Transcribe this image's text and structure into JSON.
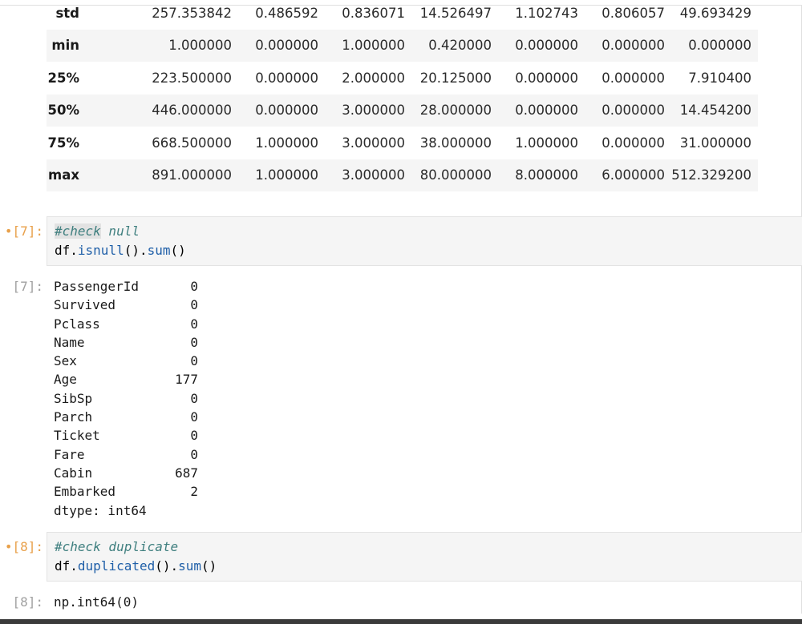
{
  "describe_table": {
    "rows": [
      {
        "label": "std",
        "values": [
          "257.353842",
          "0.486592",
          "0.836071",
          "14.526497",
          "1.102743",
          "0.806057",
          "49.693429"
        ]
      },
      {
        "label": "min",
        "values": [
          "1.000000",
          "0.000000",
          "1.000000",
          "0.420000",
          "0.000000",
          "0.000000",
          "0.000000"
        ]
      },
      {
        "label": "25%",
        "values": [
          "223.500000",
          "0.000000",
          "2.000000",
          "20.125000",
          "0.000000",
          "0.000000",
          "7.910400"
        ]
      },
      {
        "label": "50%",
        "values": [
          "446.000000",
          "0.000000",
          "3.000000",
          "28.000000",
          "0.000000",
          "0.000000",
          "14.454200"
        ]
      },
      {
        "label": "75%",
        "values": [
          "668.500000",
          "1.000000",
          "3.000000",
          "38.000000",
          "1.000000",
          "0.000000",
          "31.000000"
        ]
      },
      {
        "label": "max",
        "values": [
          "891.000000",
          "1.000000",
          "3.000000",
          "80.000000",
          "8.000000",
          "6.000000",
          "512.329200"
        ]
      }
    ]
  },
  "cells": [
    {
      "input_prompt": "[7]:",
      "comment_keyword": "#check",
      "comment_rest": " null",
      "code_var": "df",
      "code_call_1": "isnull",
      "code_call_2": "sum",
      "output_prompt": "[7]:",
      "output_series": [
        {
          "key": "PassengerId",
          "value": "0"
        },
        {
          "key": "Survived",
          "value": "0"
        },
        {
          "key": "Pclass",
          "value": "0"
        },
        {
          "key": "Name",
          "value": "0"
        },
        {
          "key": "Sex",
          "value": "0"
        },
        {
          "key": "Age",
          "value": "177"
        },
        {
          "key": "SibSp",
          "value": "0"
        },
        {
          "key": "Parch",
          "value": "0"
        },
        {
          "key": "Ticket",
          "value": "0"
        },
        {
          "key": "Fare",
          "value": "0"
        },
        {
          "key": "Cabin",
          "value": "687"
        },
        {
          "key": "Embarked",
          "value": "2"
        }
      ],
      "output_dtype": "dtype: int64"
    },
    {
      "input_prompt": "[8]:",
      "comment_text": "#check duplicate",
      "code_var": "df",
      "code_call_1": "duplicated",
      "code_call_2": "sum",
      "output_prompt": "[8]:",
      "output_text": "np.int64(0)"
    }
  ]
}
